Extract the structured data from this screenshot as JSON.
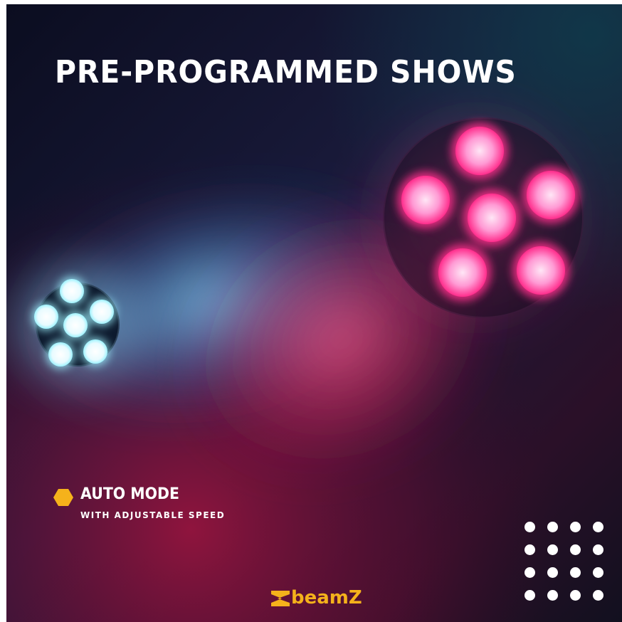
{
  "headline": "PRE-PROGRAMMED SHOWS",
  "feature": {
    "title": "AUTO MODE",
    "subtitle": "WITH ADJUSTABLE SPEED",
    "icon": "hexagon-icon"
  },
  "brand": {
    "name": "beamZ",
    "mark_icon": "beamz-logo-mark-icon"
  },
  "colors": {
    "accent": "#f5b21b",
    "text": "#ffffff",
    "background_dark": "#13172f",
    "cyan_light": "#9ff3ff",
    "magenta_light": "#ff3c9a"
  },
  "decoration": {
    "dot_grid": {
      "rows": 4,
      "columns": 4
    }
  }
}
